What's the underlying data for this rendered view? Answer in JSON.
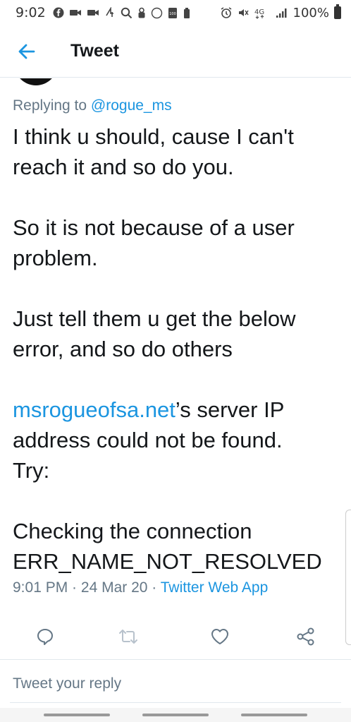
{
  "status_bar": {
    "time": "9:02",
    "battery_text": "100%",
    "network": "4G",
    "icons": [
      "facebook-icon",
      "video-icon",
      "video-icon",
      "weather-icon",
      "search-icon",
      "lock-icon",
      "circle-icon",
      "battery-saver-icon",
      "alarm-icon",
      "mute-icon",
      "lte-icon",
      "signal-icon",
      "battery-icon"
    ]
  },
  "header": {
    "title": "Tweet",
    "back_icon": "arrow-left-icon"
  },
  "tweet": {
    "replying_prefix": "Replying to ",
    "replying_to": "@rogue_ms",
    "line1": "I think u should, cause I can't reach it and so do you.",
    "line2": "So it is not because of a user problem.",
    "line3": "Just tell them u get the below error, and so do others",
    "link": "msrogueofsa.net",
    "line4_rest": "’s server IP address could not be found.",
    "line5": "Try:",
    "line6": "Checking the connection",
    "line7": "ERR_NAME_NOT_RESOLVED",
    "time": "9:01 PM",
    "sep1": " · ",
    "date": "24 Mar 20",
    "sep2": " · ",
    "app": "Twitter Web App"
  },
  "actions": {
    "reply_icon": "reply-icon",
    "retweet_icon": "retweet-icon",
    "like_icon": "heart-icon",
    "share_icon": "share-icon"
  },
  "reply_box": {
    "placeholder": "Tweet your reply"
  },
  "colors": {
    "accent": "#1b95e0",
    "text": "#14171a",
    "secondary": "#657786",
    "divider": "#e1e8ed"
  }
}
